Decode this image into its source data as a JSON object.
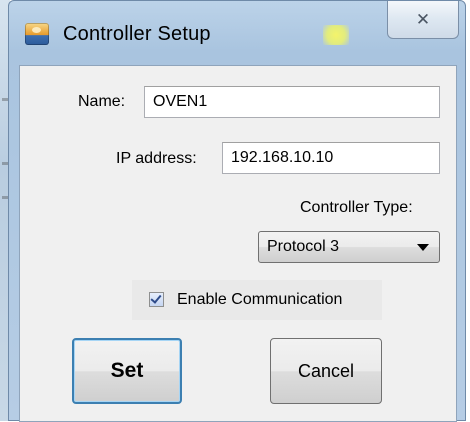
{
  "window": {
    "title": "Controller Setup",
    "close_glyph": "✕"
  },
  "form": {
    "name_label": "Name:",
    "name_value": "OVEN1",
    "ip_label": "IP address:",
    "ip_value": "192.168.10.10",
    "controller_type_label": "Controller Type:",
    "controller_type_value": "Protocol 3",
    "enable_communication_label": "Enable Communication",
    "enable_communication_checked": true
  },
  "buttons": {
    "set_label": "Set",
    "cancel_label": "Cancel"
  }
}
